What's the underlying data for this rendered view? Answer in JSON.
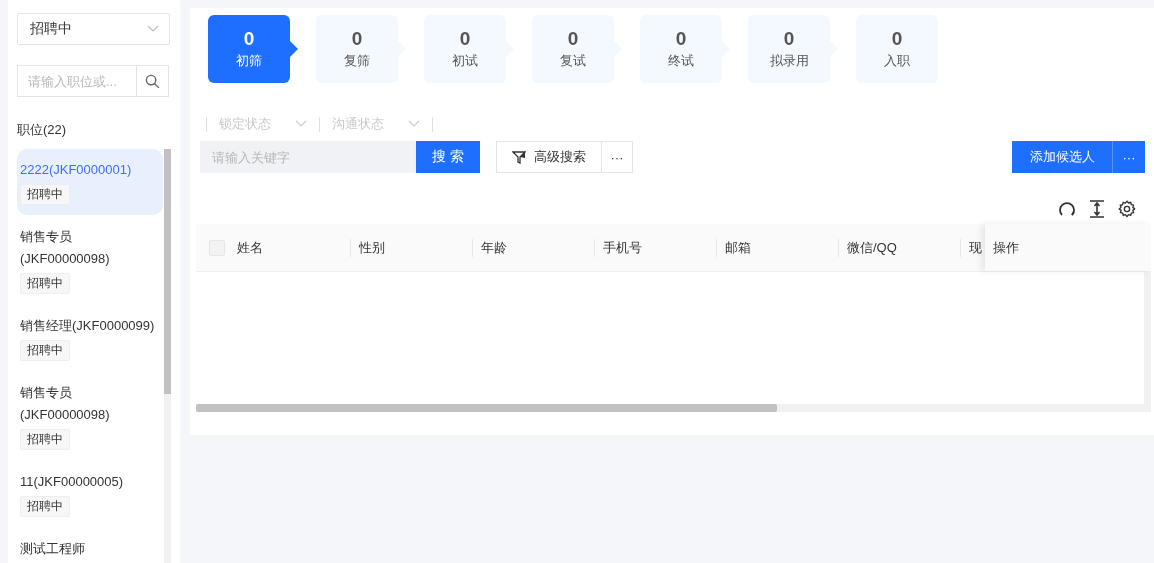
{
  "sidebar": {
    "status_select": {
      "value": "招聘中"
    },
    "search": {
      "placeholder": "请输入职位或..."
    },
    "heading": "职位(22)",
    "positions": [
      {
        "title": "2222(JKF0000001)",
        "tag": "招聘中",
        "selected": true
      },
      {
        "title": "销售专员(JKF00000098)",
        "tag": "招聘中",
        "selected": false
      },
      {
        "title": "销售经理(JKF0000099)",
        "tag": "招聘中",
        "selected": false
      },
      {
        "title": "销售专员(JKF00000098)",
        "tag": "招聘中",
        "selected": false
      },
      {
        "title": "11(JKF00000005)",
        "tag": "招聘中",
        "selected": false
      },
      {
        "title": "测试工程师",
        "selected": false
      }
    ]
  },
  "stages": [
    {
      "count": "0",
      "label": "初筛",
      "selected": true
    },
    {
      "count": "0",
      "label": "复筛",
      "selected": false
    },
    {
      "count": "0",
      "label": "初试",
      "selected": false
    },
    {
      "count": "0",
      "label": "复试",
      "selected": false
    },
    {
      "count": "0",
      "label": "终试",
      "selected": false
    },
    {
      "count": "0",
      "label": "拟录用",
      "selected": false
    },
    {
      "count": "0",
      "label": "入职",
      "selected": false
    }
  ],
  "filters": [
    {
      "placeholder": "锁定状态"
    },
    {
      "placeholder": "沟通状态"
    }
  ],
  "keyword_search": {
    "placeholder": "请输入关键字",
    "button": "搜 索"
  },
  "advanced_search": {
    "label": "高级搜索",
    "more": "···"
  },
  "add_candidate": {
    "label": "添加候选人",
    "more": "···"
  },
  "table": {
    "select_all": {
      "checked": false
    },
    "columns": [
      "姓名",
      "性别",
      "年龄",
      "手机号",
      "邮箱",
      "微信/QQ",
      "现"
    ],
    "fixed_column": "操作"
  }
}
